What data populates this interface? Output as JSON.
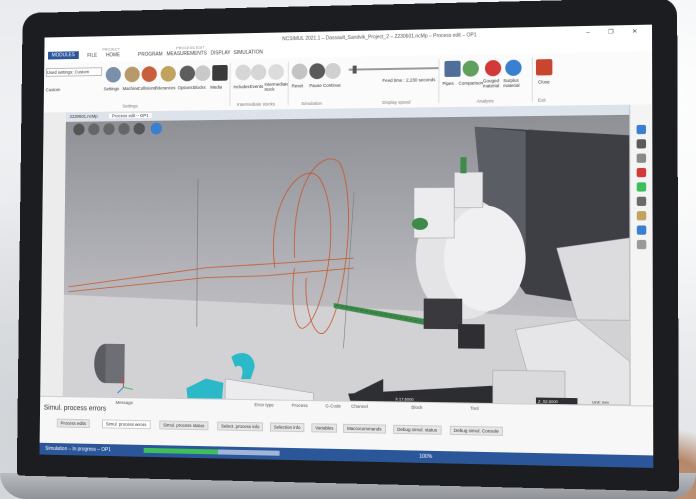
{
  "window": {
    "title": "NCSIMUL 2021.1 – Dassault_Sandvik_Project_2 – 2230601.ncMp – Process edit – OP1",
    "controls": "–  ❐  ✕"
  },
  "ribbon_tabs": [
    {
      "label": "MODULES",
      "active": true
    },
    {
      "label": "FILE"
    },
    {
      "label": "HOME"
    },
    {
      "label": "PROGRAM"
    },
    {
      "label": "MEASUREMENTS"
    },
    {
      "label": "DISPLAY"
    },
    {
      "label": "SIMULATION"
    }
  ],
  "ribbon_context": {
    "project": "PROJECT",
    "process_edit": "PROCESS EDIT"
  },
  "ribbon": {
    "settings_dropdown": "Used settings: Custom",
    "custom_label": "Custom",
    "buttons": [
      {
        "label": "Settings"
      },
      {
        "label": "Machine"
      },
      {
        "label": "Collisions"
      },
      {
        "label": "Tolerances"
      },
      {
        "label": "Options"
      },
      {
        "label": "Blocks"
      },
      {
        "label": "Media"
      },
      {
        "label": "Includes"
      },
      {
        "label": "Events"
      },
      {
        "label": "Intermediate stock"
      },
      {
        "label": "Reset"
      },
      {
        "label": "Pause"
      },
      {
        "label": "Continue"
      },
      {
        "label": "Pipes"
      },
      {
        "label": "Comparison"
      },
      {
        "label": "Gouged material"
      },
      {
        "label": "Surplus material"
      },
      {
        "label": "Close"
      }
    ],
    "groups": [
      "Settings",
      "Intermediate stocks",
      "Simulation",
      "Display speed",
      "Analysis",
      "Exit"
    ],
    "feed_time": "Feed time : 2,230 seconds"
  },
  "doc_tabs": [
    "2230601.ncMp",
    "Process edit – OP1"
  ],
  "viewport": {
    "coords": "Z -52.6000",
    "status_left": "X 17.6000",
    "status_mid": "Unit: mm"
  },
  "bottom_panel": {
    "title": "Simul. process errors",
    "columns": [
      "Message",
      "Error type",
      "Process",
      "G-Code",
      "Channel",
      "Block",
      "Tool"
    ],
    "tabs": [
      "Process edits",
      "Simul. process errors",
      "Simul. process status",
      "Select. process info",
      "Selection info",
      "Variables",
      "Macrocommands",
      "Debug simul. status",
      "Debug simul. Console"
    ]
  },
  "status": {
    "text": "Simulation – In progress – OP1",
    "progress": 0.55,
    "percent": "100%"
  },
  "colors": {
    "accent": "#2b579a",
    "tool_cyan": "#2bb8c9",
    "drill_green": "#3d8a4a",
    "toolpath": "#c8552a"
  }
}
